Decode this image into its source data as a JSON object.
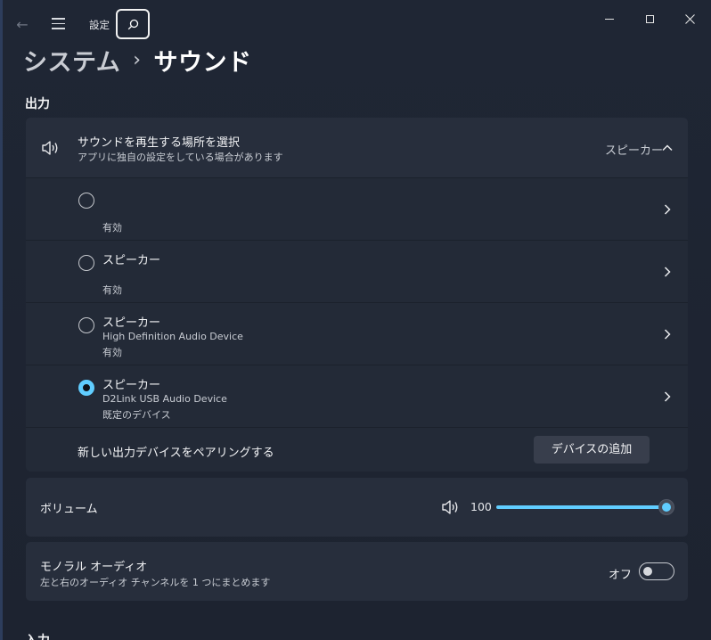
{
  "titlebar": {
    "title": "設定"
  },
  "breadcrumb": {
    "parent": "システム",
    "separator": "›",
    "current": "サウンド"
  },
  "output": {
    "section_label": "出力",
    "select_location": {
      "title": "サウンドを再生する場所を選択",
      "subtitle": "アプリに独自の設定をしている場合があります",
      "current_value": "スピーカー"
    },
    "devices": [
      {
        "name": "",
        "description": "",
        "status": "有効",
        "selected": false
      },
      {
        "name": "スピーカー",
        "description": "",
        "status": "有効",
        "selected": false
      },
      {
        "name": "スピーカー",
        "description": "High Definition Audio Device",
        "status": "有効",
        "selected": false
      },
      {
        "name": "スピーカー",
        "description": "D2Link USB Audio Device",
        "status": "既定のデバイス",
        "selected": true
      }
    ],
    "pair": {
      "label": "新しい出力デバイスをペアリングする",
      "button": "デバイスの追加"
    },
    "volume": {
      "label": "ボリューム",
      "value": "100",
      "level_percent": 100
    },
    "mono": {
      "title": "モノラル オーディオ",
      "subtitle": "左と右のオーディオ チャンネルを 1 つにまとめます",
      "state_label": "オフ",
      "on": false
    }
  },
  "input": {
    "section_label": "入力"
  },
  "colors": {
    "accent": "#60cdff",
    "background": "#1e2533",
    "card": "#272e3c"
  }
}
